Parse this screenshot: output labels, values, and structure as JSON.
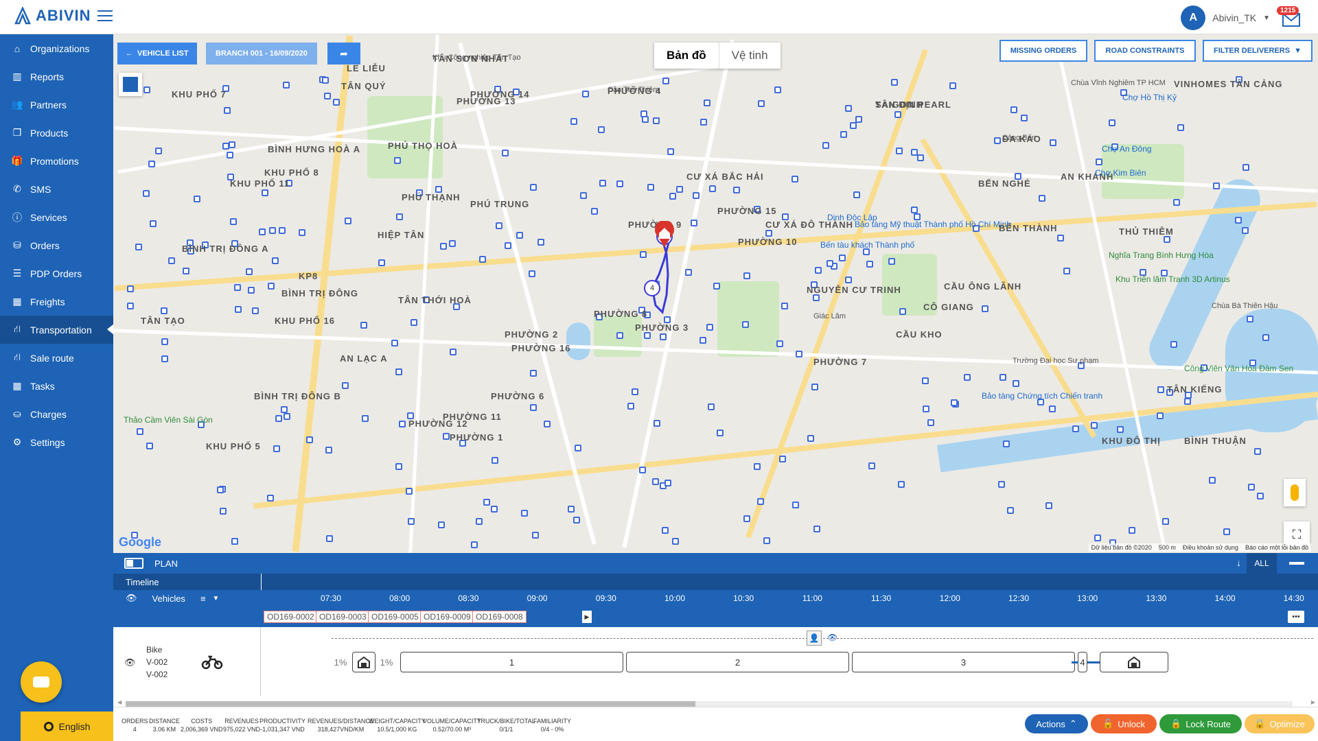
{
  "app": {
    "brand": "ABIVIN"
  },
  "user": {
    "name": "Abivin_TK",
    "notifications": "1215",
    "avatar_letter": "A"
  },
  "sidebar": {
    "items": [
      {
        "label": "Organizations",
        "icon": "home-icon"
      },
      {
        "label": "Reports",
        "icon": "bar-chart-icon"
      },
      {
        "label": "Partners",
        "icon": "users-icon"
      },
      {
        "label": "Products",
        "icon": "cubes-icon"
      },
      {
        "label": "Promotions",
        "icon": "gift-icon"
      },
      {
        "label": "SMS",
        "icon": "phone-icon"
      },
      {
        "label": "Services",
        "icon": "info-icon"
      },
      {
        "label": "Orders",
        "icon": "orders-icon"
      },
      {
        "label": "PDP Orders",
        "icon": "list-icon"
      },
      {
        "label": "Freights",
        "icon": "freight-icon"
      },
      {
        "label": "Transportation",
        "icon": "road-icon",
        "active": true
      },
      {
        "label": "Sale route",
        "icon": "route-icon"
      },
      {
        "label": "Tasks",
        "icon": "calendar-icon"
      },
      {
        "label": "Charges",
        "icon": "charges-icon"
      },
      {
        "label": "Settings",
        "icon": "gear-icon"
      }
    ]
  },
  "language": "English",
  "map": {
    "vehicle_list": "VEHICLE LIST",
    "branch": "BRANCH 001 - 16/09/2020",
    "map_type": {
      "map": "Bản đồ",
      "satellite": "Vệ tinh"
    },
    "actions": {
      "missing_orders": "MISSING ORDERS",
      "road_constraints": "ROAD CONSTRAINTS",
      "filter_deliverers": "FILTER DELIVERERS"
    },
    "google": "Google",
    "attribution": [
      "Dữ liệu bản đồ ©2020",
      "500 m",
      "Điều khoản sử dụng",
      "Báo cáo một lỗi bản đồ"
    ],
    "labels": [
      {
        "t": "TÂN SƠN NHẤT",
        "c": "district"
      },
      {
        "t": "PHƯỜNG 4",
        "c": "district"
      },
      {
        "t": "TÂN ĐỊNH",
        "c": "district"
      },
      {
        "t": "ĐA KAO",
        "c": "district"
      },
      {
        "t": "BẾN THÀNH",
        "c": "district"
      },
      {
        "t": "PHƯỜNG 10",
        "c": "district"
      },
      {
        "t": "KHU PHỐ 7",
        "c": "district"
      },
      {
        "t": "BÌNH HƯNG HOÀ A",
        "c": "district"
      },
      {
        "t": "KHU PHỐ 8",
        "c": "district"
      },
      {
        "t": "KHU PHỐ 11",
        "c": "district"
      },
      {
        "t": "PHÚ THỌ HOÀ",
        "c": "district"
      },
      {
        "t": "PHÚ THẠNH",
        "c": "district"
      },
      {
        "t": "PHÚ TRUNG",
        "c": "district"
      },
      {
        "t": "HIỆP TÂN",
        "c": "district"
      },
      {
        "t": "TÂN THỚI HOÀ",
        "c": "district"
      },
      {
        "t": "BÌNH TRỊ ĐÔNG",
        "c": "district"
      },
      {
        "t": "BÌNH TRỊ ĐÔNG A",
        "c": "district"
      },
      {
        "t": "TÂN TẠO",
        "c": "district"
      },
      {
        "t": "KHU PHỐ 16",
        "c": "district"
      },
      {
        "t": "AN LẠC A",
        "c": "district"
      },
      {
        "t": "BÌNH TRỊ ĐÔNG B",
        "c": "district"
      },
      {
        "t": "KHU PHỐ 5",
        "c": "district"
      },
      {
        "t": "CƯ XÁ BẮC HẢI",
        "c": "district"
      },
      {
        "t": "CƯ XÁ ĐÔ THÀNH",
        "c": "district"
      },
      {
        "t": "CẦU ÔNG LÃNH",
        "c": "district"
      },
      {
        "t": "CÔ GIANG",
        "c": "district"
      },
      {
        "t": "CẦU KHO",
        "c": "district"
      },
      {
        "t": "NGUYỄN CƯ TRINH",
        "c": "district"
      },
      {
        "t": "BẾN NGHÉ",
        "c": "district"
      },
      {
        "t": "AN KHÁNH",
        "c": "district"
      },
      {
        "t": "THỦ THIÊM",
        "c": "district"
      },
      {
        "t": "VINHOMES TÂN CẢNG",
        "c": "district"
      },
      {
        "t": "TÂN KIỂNG",
        "c": "district"
      },
      {
        "t": "KHU ĐÔ THỊ",
        "c": "district"
      },
      {
        "t": "BÌNH THUẬN",
        "c": "district"
      },
      {
        "t": "LÊ LIỄU",
        "c": "district"
      },
      {
        "t": "TÂN QUÝ",
        "c": "district"
      },
      {
        "t": "KP8",
        "c": "district"
      },
      {
        "t": "PHƯỜNG 15",
        "c": "district"
      },
      {
        "t": "PHƯỜNG 9",
        "c": "district"
      },
      {
        "t": "PHƯỜNG 14",
        "c": "district"
      },
      {
        "t": "PHƯỜNG 13",
        "c": "district"
      },
      {
        "t": "PHƯỜNG 8",
        "c": "district"
      },
      {
        "t": "PHƯỜNG 2",
        "c": "district"
      },
      {
        "t": "PHƯỜNG 16",
        "c": "district"
      },
      {
        "t": "PHƯỜNG 11",
        "c": "district"
      },
      {
        "t": "PHƯỜNG 12",
        "c": "district"
      },
      {
        "t": "PHƯỜNG 1",
        "c": "district"
      },
      {
        "t": "PHƯỜNG 3",
        "c": "district"
      },
      {
        "t": "PHƯỜNG 6",
        "c": "district"
      },
      {
        "t": "PHƯỜNG 7",
        "c": "district"
      },
      {
        "t": "Nghĩa Trang Bình Hưng Hòa",
        "c": "green"
      },
      {
        "t": "Công Viên Văn Hóa Đầm Sen",
        "c": "green"
      },
      {
        "t": "Thảo Cầm Viên Sài Gòn",
        "c": "green"
      },
      {
        "t": "Khu Triển lãm Tranh 3D Artinus",
        "c": "green"
      },
      {
        "t": "Chợ Hồ Thị Kỷ",
        "c": "blue"
      },
      {
        "t": "Chợ An Đông",
        "c": "blue"
      },
      {
        "t": "Chợ Kim Biên",
        "c": "blue"
      },
      {
        "t": "Bảo tàng Chứng tích Chiến tranh",
        "c": "blue"
      },
      {
        "t": "Dinh Độc Lập",
        "c": "blue"
      },
      {
        "t": "Bảo tàng Mỹ thuật Thành phố Hồ Chí Minh",
        "c": "blue"
      },
      {
        "t": "Bến tàu khách Thành phố",
        "c": "blue"
      },
      {
        "t": "Giác Lâm",
        "c": "small"
      },
      {
        "t": "Trường Đại học Sư phạm",
        "c": "small"
      },
      {
        "t": "Chùa Vĩnh Nghiêm TP HCM",
        "c": "small"
      },
      {
        "t": "Chùa Bà Thiên Hậu",
        "c": "small"
      },
      {
        "t": "Khu Công nghiệp Tân Tạo",
        "c": "small"
      },
      {
        "t": "Cầu Thủ Thiêm",
        "c": "small"
      },
      {
        "t": "SAIGON PEARL",
        "c": "district"
      },
      {
        "t": "Cảng Bến",
        "c": "small"
      }
    ],
    "route_stops": [
      "1",
      "2",
      "3",
      "4"
    ]
  },
  "plan": {
    "title": "PLAN",
    "all": "ALL",
    "timeline": "Timeline",
    "vehicles_header": "Vehicles",
    "hours": [
      "07:30",
      "08:00",
      "08:30",
      "09:00",
      "09:30",
      "10:00",
      "10:30",
      "11:00",
      "11:30",
      "12:00",
      "12:30",
      "13:00",
      "13:30",
      "14:00",
      "14:30"
    ],
    "orders": [
      "OD169-0002",
      "OD169-0003",
      "OD169-0005",
      "OD169-0009",
      "OD169-0008"
    ],
    "vehicle": {
      "type": "Bike",
      "plate": "V-002",
      "name": "V-002"
    },
    "timeline_boxes": [
      {
        "label": "1%",
        "kind": "pct"
      },
      {
        "label": "",
        "kind": "depot"
      },
      {
        "label": "1%",
        "kind": "pct"
      },
      {
        "label": "1",
        "kind": "stop"
      },
      {
        "label": "2",
        "kind": "stop"
      },
      {
        "label": "3",
        "kind": "stop"
      },
      {
        "label": "4",
        "kind": "stop"
      },
      {
        "label": "",
        "kind": "depot"
      }
    ]
  },
  "stats": [
    {
      "label": "ORDERS",
      "value": "4"
    },
    {
      "label": "DISTANCE",
      "value": "3.06 KM"
    },
    {
      "label": "COSTS",
      "value": "2,006,369 VND"
    },
    {
      "label": "REVENUES",
      "value": "975,022 VND"
    },
    {
      "label": "PRODUCTIVITY",
      "value": "-1,031,347 VND"
    },
    {
      "label": "REVENUES/DISTANCE",
      "value": "318,427VND/KM"
    },
    {
      "label": "WEIGHT/CAPACITY",
      "value": "10.5/1,000 KG"
    },
    {
      "label": "VOLUME/CAPACITY",
      "value": "0.52/70.00 M³"
    },
    {
      "label": "TRUCK/BIKE/TOTAL",
      "value": "0/1/1"
    },
    {
      "label": "FAMILIARITY",
      "value": "0/4 - 0%"
    }
  ],
  "buttons": {
    "actions": "Actions",
    "unlock": "Unlock",
    "lock_route": "Lock Route",
    "optimize": "Optimize"
  },
  "colors": {
    "primary": "#1e63b5",
    "accent": "#3a86e6",
    "unlock": "#f0642d",
    "lock": "#2e9a3a",
    "optimize": "#f9c45a"
  }
}
